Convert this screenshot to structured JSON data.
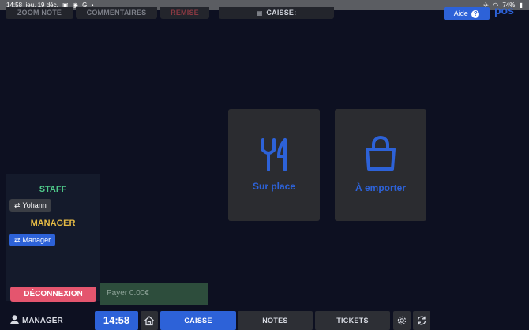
{
  "status_bar": {
    "time": "14:58",
    "date": "jeu. 19 déc.",
    "battery": "74%"
  },
  "top_toolbar": {
    "zoom_note": "ZOOM NOTE",
    "commentaires": "COMMENTAIRES",
    "remise": "REMISE",
    "caisse": "CAISSE:"
  },
  "help": {
    "label": "Aide",
    "icon": "?"
  },
  "brand": {
    "logo_text": "pos"
  },
  "order_types": [
    {
      "label": "Sur place",
      "icon": "fork-knife-icon"
    },
    {
      "label": "À emporter",
      "icon": "shopping-bag-icon"
    }
  ],
  "staff_panel": {
    "staff_title": "STAFF",
    "staff_user": "Yohann",
    "manager_title": "MANAGER",
    "manager_user": "Manager"
  },
  "actions": {
    "logout": "DÉCONNEXION",
    "pay": "Payer 0.00€"
  },
  "bottom_nav": {
    "user": "MANAGER",
    "time": "14:58",
    "tabs": [
      "CAISSE",
      "NOTES",
      "TICKETS"
    ],
    "active_tab": "CAISSE"
  },
  "colors": {
    "background": "#0d1021",
    "accent": "#2d62d8",
    "staff": "#4fc98a",
    "manager": "#e6bb45",
    "logout": "#e4556e",
    "pay": "#2d4d3c"
  }
}
